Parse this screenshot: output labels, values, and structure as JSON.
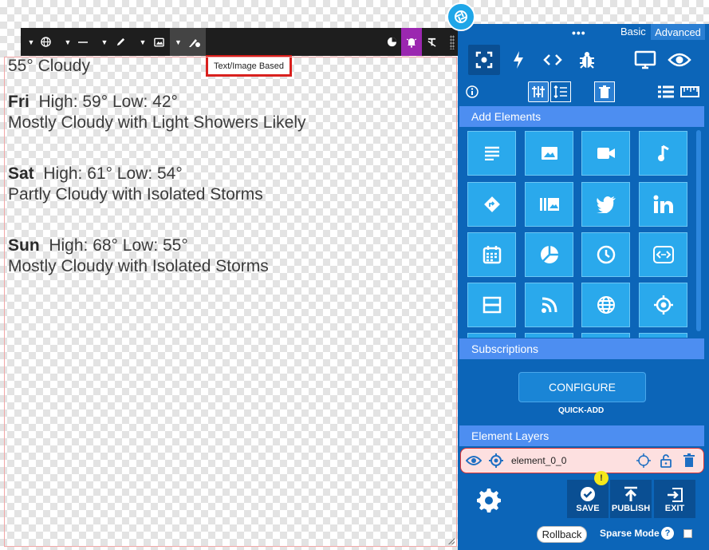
{
  "toolbar": {
    "tooltip": "Text/Image Based",
    "colors": {
      "background": "#1e1e1e",
      "active": "#9b27b0"
    }
  },
  "weather": {
    "current": "55° Cloudy",
    "days": [
      {
        "day": "Fri",
        "temps": "High: 59°  Low: 42°",
        "desc": "Mostly Cloudy with Light Showers Likely"
      },
      {
        "day": "Sat",
        "temps": "High: 61°  Low: 54°",
        "desc": "Partly Cloudy with Isolated Storms"
      },
      {
        "day": "Sun",
        "temps": "High: 68°  Low: 55°",
        "desc": "Mostly Cloudy with Isolated Storms"
      }
    ]
  },
  "panel": {
    "mode_dots": "•••",
    "mode_basic": "Basic",
    "mode_advanced": "Advanced",
    "add_elements": "Add Elements",
    "subscriptions": "Subscriptions",
    "configure": "CONFIGURE",
    "quick_add": "QUICK-ADD",
    "element_layers": "Element Layers",
    "layer_name": "element_0_0",
    "save": "SAVE",
    "publish": "PUBLISH",
    "exit": "EXIT",
    "save_badge": "!",
    "rollback": "Rollback",
    "sparse_mode": "Sparse Mode",
    "help": "?",
    "colors": {
      "panel": "#0c65b8",
      "header": "#4d8ef1",
      "tile": "#2aa9ec",
      "layer_row": "#fde0e0"
    }
  }
}
